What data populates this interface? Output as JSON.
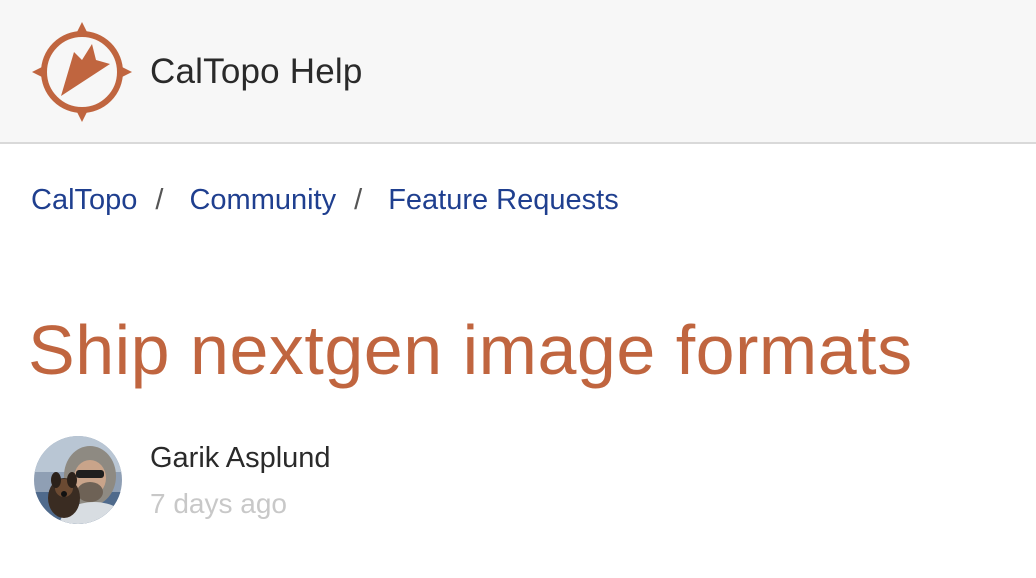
{
  "header": {
    "site_title": "CalTopo Help",
    "brand_color": "#c0653f",
    "logo_icon": "compass-arrow-icon"
  },
  "breadcrumb": {
    "items": [
      "CalTopo",
      "Community",
      "Feature Requests"
    ],
    "separator": "/"
  },
  "article": {
    "title": "Ship nextgen image formats",
    "author": "Garik Asplund",
    "posted": "7 days ago"
  }
}
